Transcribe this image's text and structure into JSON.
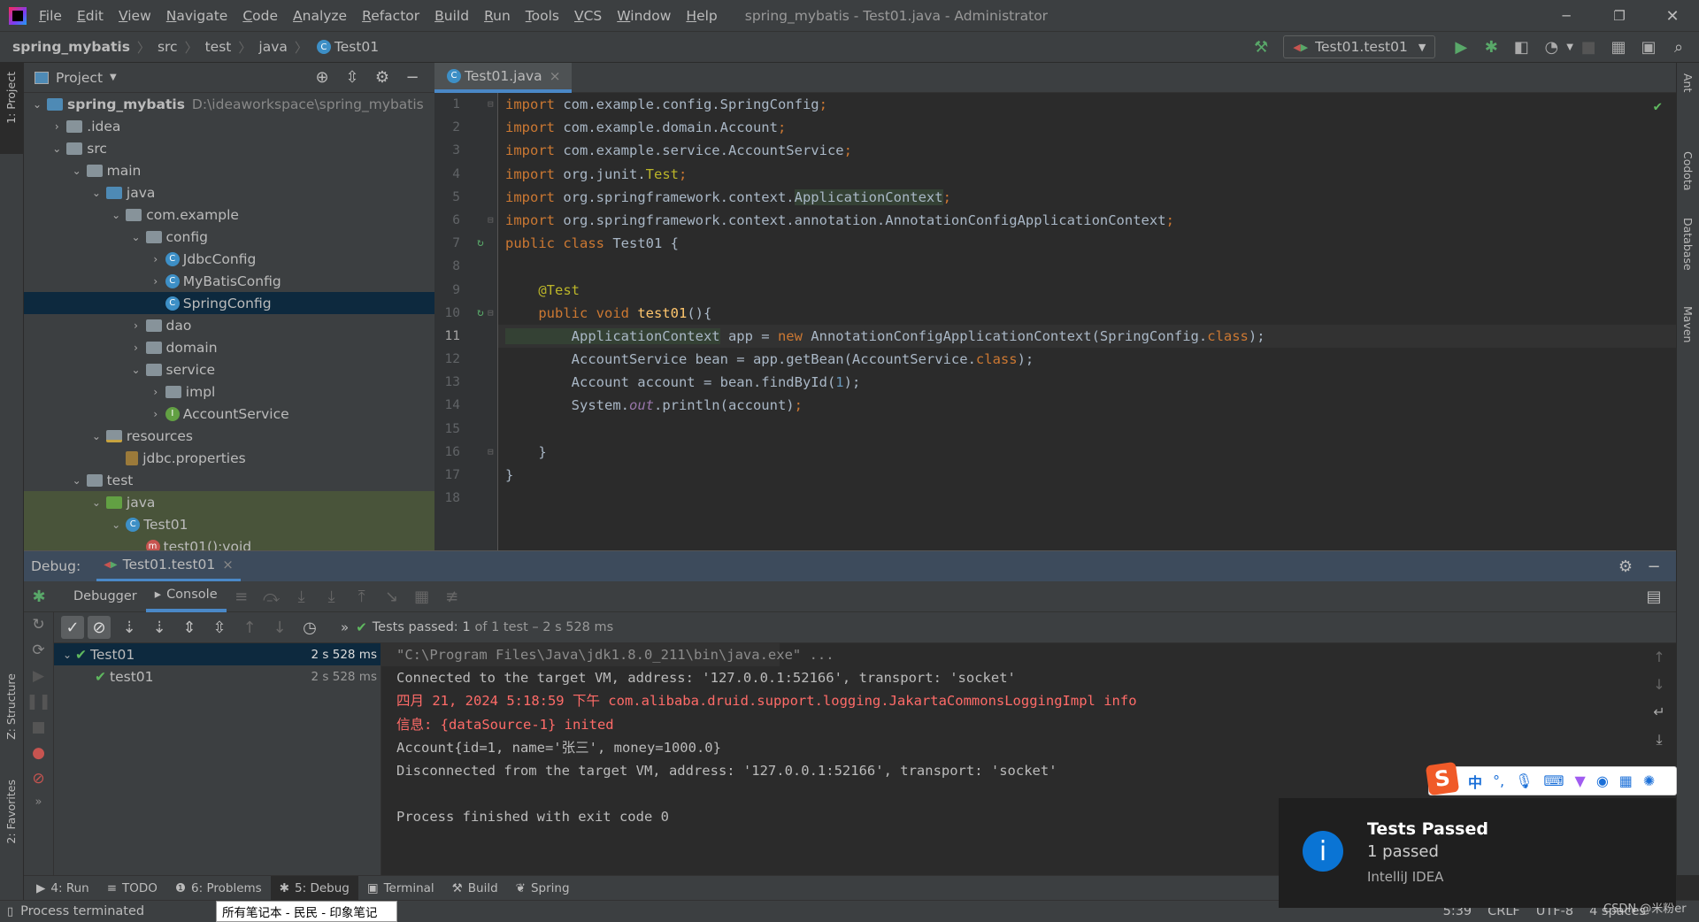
{
  "window": {
    "title": "spring_mybatis - Test01.java - Administrator",
    "menu": [
      "File",
      "Edit",
      "View",
      "Navigate",
      "Code",
      "Analyze",
      "Refactor",
      "Build",
      "Run",
      "Tools",
      "VCS",
      "Window",
      "Help"
    ]
  },
  "breadcrumb": [
    "spring_mybatis",
    "src",
    "test",
    "java",
    "Test01"
  ],
  "toolbar": {
    "run_config": "Test01.test01",
    "icons": [
      "build-hammer-icon",
      "run-icon",
      "debug-icon",
      "coverage-icon",
      "profiler-icon",
      "stop-icon",
      "project-structure-icon",
      "terminal-icon",
      "search-icon"
    ]
  },
  "left_strip": [
    "1: Project",
    "Z: Structure",
    "2: Favorites"
  ],
  "right_strip": [
    "Ant",
    "Codota",
    "Database",
    "Maven"
  ],
  "project": {
    "title": "Project",
    "items": [
      {
        "level": 0,
        "label": "spring_mybatis",
        "path": "D:\\ideaworkspace\\spring_mybatis",
        "type": "module",
        "state": "open"
      },
      {
        "level": 1,
        "label": ".idea",
        "type": "folder",
        "state": "closed"
      },
      {
        "level": 1,
        "label": "src",
        "type": "folder",
        "state": "open"
      },
      {
        "level": 2,
        "label": "main",
        "type": "folder",
        "state": "open"
      },
      {
        "level": 3,
        "label": "java",
        "type": "folder-blue",
        "state": "open"
      },
      {
        "level": 4,
        "label": "com.example",
        "type": "folder",
        "state": "open"
      },
      {
        "level": 5,
        "label": "config",
        "type": "folder",
        "state": "open"
      },
      {
        "level": 6,
        "label": "JdbcConfig",
        "type": "class",
        "state": "closed"
      },
      {
        "level": 6,
        "label": "MyBatisConfig",
        "type": "class",
        "state": "closed"
      },
      {
        "level": 6,
        "label": "SpringConfig",
        "type": "class",
        "state": "none",
        "selected": true
      },
      {
        "level": 5,
        "label": "dao",
        "type": "folder",
        "state": "closed"
      },
      {
        "level": 5,
        "label": "domain",
        "type": "folder",
        "state": "closed"
      },
      {
        "level": 5,
        "label": "service",
        "type": "folder",
        "state": "open"
      },
      {
        "level": 6,
        "label": "impl",
        "type": "folder",
        "state": "closed"
      },
      {
        "level": 6,
        "label": "AccountService",
        "type": "interface",
        "state": "closed"
      },
      {
        "level": 3,
        "label": "resources",
        "type": "folder-res",
        "state": "open"
      },
      {
        "level": 4,
        "label": "jdbc.properties",
        "type": "props",
        "state": "none"
      },
      {
        "level": 2,
        "label": "test",
        "type": "folder",
        "state": "open"
      },
      {
        "level": 3,
        "label": "java",
        "type": "folder-green",
        "state": "open",
        "test": true
      },
      {
        "level": 4,
        "label": "Test01",
        "type": "class",
        "state": "open",
        "test": true
      },
      {
        "level": 5,
        "label": "test01():void",
        "type": "method",
        "state": "none",
        "test": true
      }
    ]
  },
  "editor": {
    "tab": "Test01.java",
    "current_line": 11,
    "lines": [
      [
        [
          "import ",
          "kw"
        ],
        [
          "com.example.config.SpringConfig",
          "plain"
        ],
        [
          ";",
          "kw"
        ]
      ],
      [
        [
          "import ",
          "kw"
        ],
        [
          "com.example.domain.Account",
          "plain"
        ],
        [
          ";",
          "kw"
        ]
      ],
      [
        [
          "import ",
          "kw"
        ],
        [
          "com.example.service.AccountService",
          "plain"
        ],
        [
          ";",
          "kw"
        ]
      ],
      [
        [
          "import ",
          "kw"
        ],
        [
          "org.junit.",
          "plain"
        ],
        [
          "Test",
          "ann"
        ],
        [
          ";",
          "kw"
        ]
      ],
      [
        [
          "import ",
          "kw"
        ],
        [
          "org.springframework.context.",
          "plain"
        ],
        [
          "ApplicationContext",
          "hl"
        ],
        [
          ";",
          "kw"
        ]
      ],
      [
        [
          "import ",
          "kw"
        ],
        [
          "org.springframework.context.annotation.AnnotationConfigApplicationContext",
          "plain"
        ],
        [
          ";",
          "kw"
        ]
      ],
      [
        [
          "public class ",
          "kw"
        ],
        [
          "Test01 {",
          "plain"
        ]
      ],
      [],
      [
        [
          "    @Test",
          "ann"
        ]
      ],
      [
        [
          "    public void ",
          "kw"
        ],
        [
          "test01",
          "fn"
        ],
        [
          "(){",
          "plain"
        ]
      ],
      [
        [
          "        ApplicationContext",
          "hl"
        ],
        [
          " app = ",
          "plain"
        ],
        [
          "new ",
          "kw"
        ],
        [
          "AnnotationConfigApplicationContext(SpringConfig.",
          "plain"
        ],
        [
          "class",
          "kw"
        ],
        [
          ");",
          "plain"
        ]
      ],
      [
        [
          "        AccountService bean = app.getBean(AccountService.",
          "plain"
        ],
        [
          "class",
          "kw"
        ],
        [
          ");",
          "plain"
        ]
      ],
      [
        [
          "        Account account = bean.findById(",
          "plain"
        ],
        [
          "1",
          "num"
        ],
        [
          ");",
          "plain"
        ]
      ],
      [
        [
          "        System.",
          "plain"
        ],
        [
          "out",
          "fld"
        ],
        [
          ".println(account)",
          "plain"
        ],
        [
          ";",
          "kw"
        ]
      ],
      [],
      [
        [
          "    }",
          "plain"
        ]
      ],
      [
        [
          "}",
          "plain"
        ]
      ],
      []
    ]
  },
  "debug": {
    "label": "Debug:",
    "session_tab": "Test01.test01",
    "tabs": [
      "Debugger",
      "Console"
    ],
    "tests_status": {
      "prefix": "Tests passed:",
      "count": "1",
      "suffix": "of 1 test – 2 s 528 ms"
    },
    "tree": [
      {
        "label": "Test01",
        "time": "2 s 528 ms",
        "level": 0
      },
      {
        "label": "test01",
        "time": "2 s 528 ms",
        "level": 1
      }
    ],
    "console": [
      {
        "text": "\"C:\\Program Files\\Java\\jdk1.8.0_211\\bin\\java.exe\" ...",
        "style": "gray"
      },
      {
        "text": "Connected to the target VM, address: '127.0.0.1:52166', transport: 'socket'",
        "style": "normal"
      },
      {
        "text": "四月 21, 2024 5:18:59 下午 com.alibaba.druid.support.logging.JakartaCommonsLoggingImpl info",
        "style": "red"
      },
      {
        "text": "信息: {dataSource-1} inited",
        "style": "red"
      },
      {
        "text": "Account{id=1, name='张三', money=1000.0}",
        "style": "normal"
      },
      {
        "text": "Disconnected from the target VM, address: '127.0.0.1:52166', transport: 'socket'",
        "style": "normal"
      },
      {
        "text": "",
        "style": "normal"
      },
      {
        "text": "Process finished with exit code 0",
        "style": "normal"
      }
    ]
  },
  "bottom_tabs": [
    {
      "label": "4: Run"
    },
    {
      "label": "TODO"
    },
    {
      "label": "6: Problems"
    },
    {
      "label": "5: Debug",
      "active": true
    },
    {
      "label": "Terminal"
    },
    {
      "label": "Build"
    },
    {
      "label": "Spring"
    }
  ],
  "status": {
    "message": "Process terminated",
    "position": "5:39",
    "line_sep": "CRLF",
    "encoding": "UTF-8",
    "indent": "4 spaces"
  },
  "tooltip": "所有笔记本 - 民民 - 印象笔记",
  "notification": {
    "title": "Tests Passed",
    "body": "1 passed",
    "source": "IntelliJ IDEA"
  },
  "ime": {
    "mode": "中",
    "punct": "°,"
  },
  "watermark": "CSDN @米粉er",
  "colors": {
    "accent": "#4a88c7",
    "success": "#5fb85f",
    "error": "#ff6b68",
    "keyword": "#cc7832"
  }
}
